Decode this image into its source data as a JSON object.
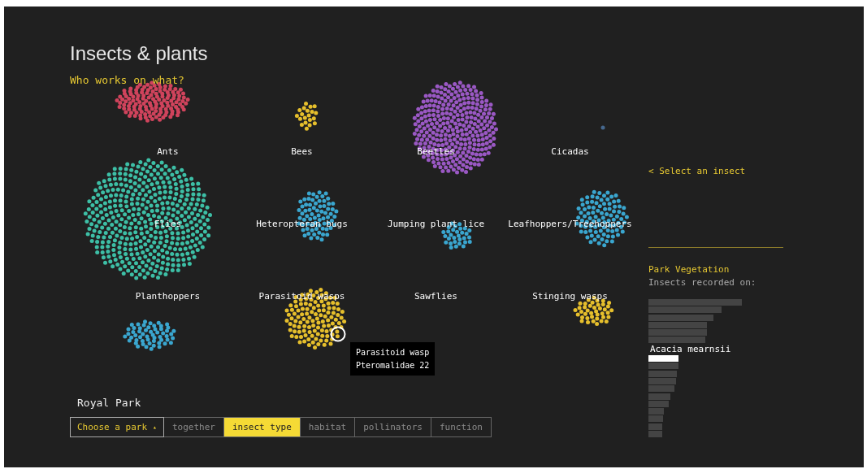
{
  "title": "Insects & plants",
  "subtitle": "Who works on what?",
  "groups": [
    {
      "label": "Ants",
      "color": "#d0435c"
    },
    {
      "label": "Bees",
      "color": "#e6bf2c"
    },
    {
      "label": "Beetles",
      "color": "#9a58c4"
    },
    {
      "label": "Cicadas",
      "color": "#46688e"
    },
    {
      "label": "Flies",
      "color": "#3dbfa6"
    },
    {
      "label": "Heteropteran bugs",
      "color": "#3aa6cf"
    },
    {
      "label": "Jumping plant lice",
      "color": "#3aa6cf"
    },
    {
      "label": "Leafhoppers/Treehoppers",
      "color": "#3aa6cf"
    },
    {
      "label": "Planthoppers",
      "color": "#3aa6cf"
    },
    {
      "label": "Parasitoid wasps",
      "color": "#e6bf2c"
    },
    {
      "label": "Sawflies"
    },
    {
      "label": "Stinging wasps",
      "color": "#e6bf2c"
    }
  ],
  "tooltip": {
    "line_1": "Parasitoid wasp",
    "line_2": "Pteromalidae 22"
  },
  "park": {
    "name": "Royal Park",
    "dropdown": "Choose a park",
    "caret": "▴"
  },
  "tabs": [
    {
      "label": "together",
      "selected": false
    },
    {
      "label": "insect type",
      "selected": true
    },
    {
      "label": "habitat",
      "selected": false
    },
    {
      "label": "pollinators",
      "selected": false
    },
    {
      "label": "function",
      "selected": false
    }
  ],
  "back_link": "< Select an insect",
  "vegetation": {
    "title": "Park Vegetation",
    "subtitle": "Insects recorded on:",
    "highlight_label": "Acacia mearnsii"
  }
}
